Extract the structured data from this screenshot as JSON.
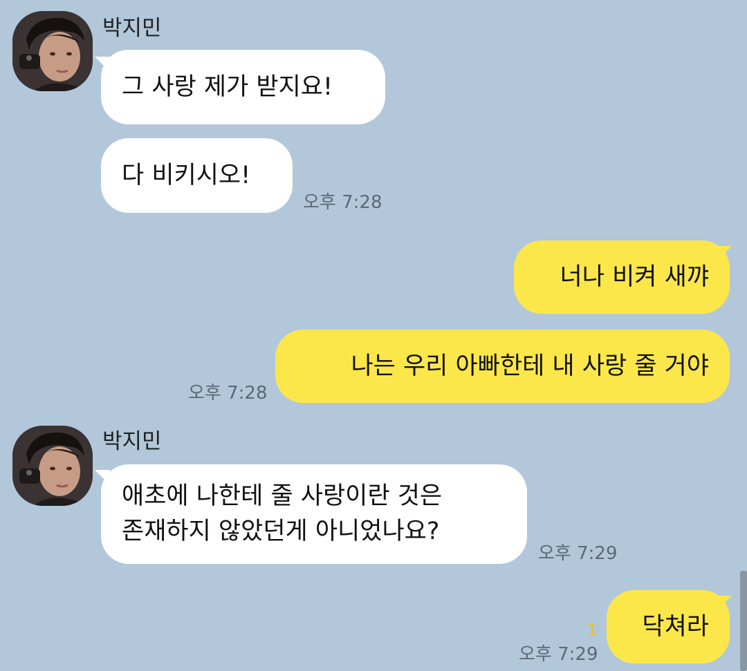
{
  "theme": {
    "background": "#b2c7da",
    "incoming_bubble": "#ffffff",
    "outgoing_bubble": "#fbe74a",
    "time_color": "#5d6874",
    "unread_color": "#e3c41e"
  },
  "groups": [
    {
      "sender": "박지민",
      "avatar_icon": "profile-photo-avatar",
      "messages": [
        "그 사랑 제가 받지요!",
        "다 비키시오!"
      ],
      "time": "오후 7:28"
    },
    {
      "sender": "me",
      "messages": [
        "너나 비켜 새꺄",
        "나는 우리 아빠한테 내 사랑 줄 거야"
      ],
      "time": "오후 7:28"
    },
    {
      "sender": "박지민",
      "avatar_icon": "profile-photo-avatar",
      "messages": [
        "애초에 나한테 줄 사랑이란 것은\n존재하지 않았던게 아니었나요?"
      ],
      "time": "오후 7:29"
    },
    {
      "sender": "me",
      "messages": [
        "닥쳐라"
      ],
      "unread": "1",
      "time": "오후 7:29"
    }
  ]
}
